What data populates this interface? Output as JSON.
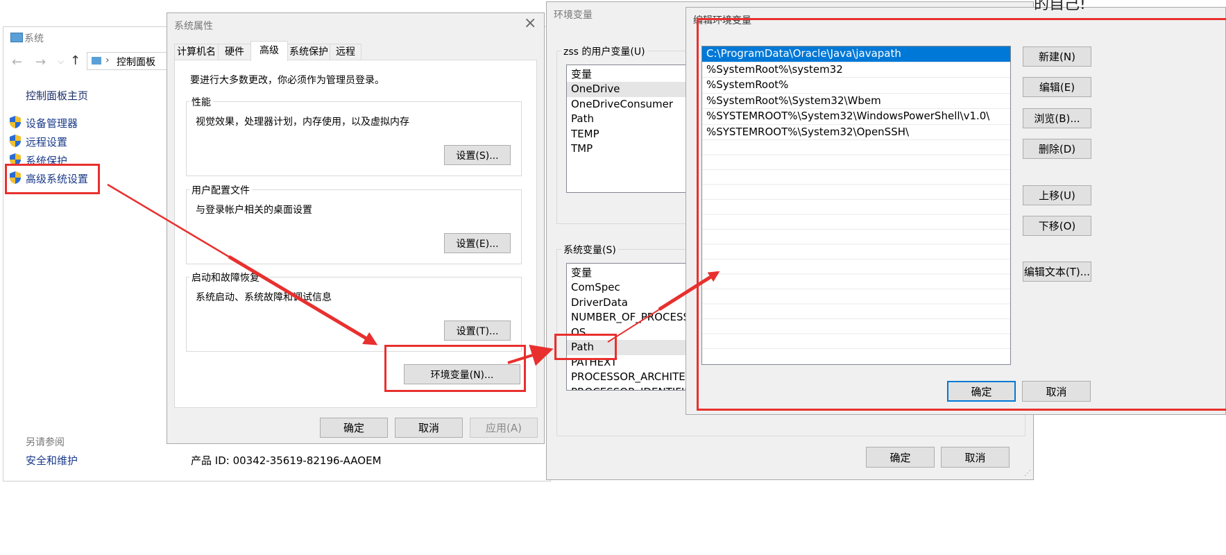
{
  "system_window": {
    "title": "系统",
    "address_label": "控制面板",
    "home_link": "控制面板主页",
    "nav_items": [
      "设备管理器",
      "远程设置",
      "系统保护",
      "高级系统设置"
    ],
    "see_also": "另请参阅",
    "security_link": "安全和维护",
    "product_id": "产品 ID: 00342-35619-82196-AAOEM"
  },
  "sys_props": {
    "title": "系统属性",
    "close": "×",
    "tabs": [
      "计算机名",
      "硬件",
      "高级",
      "系统保护",
      "远程"
    ],
    "admin_note": "要进行大多数更改，你必须作为管理员登录。",
    "perf_label": "性能",
    "perf_desc": "视觉效果，处理器计划，内存使用，以及虚拟内存",
    "perf_btn": "设置(S)...",
    "profile_label": "用户配置文件",
    "profile_desc": "与登录帐户相关的桌面设置",
    "profile_btn": "设置(E)...",
    "startup_label": "启动和故障恢复",
    "startup_desc": "系统启动、系统故障和调试信息",
    "startup_btn": "设置(T)...",
    "env_btn": "环境变量(N)...",
    "ok": "确定",
    "cancel": "取消",
    "apply": "应用(A)"
  },
  "env_vars": {
    "title": "环境变量",
    "user_label": "zss 的用户变量(U)",
    "user_header": "变量",
    "user_vars": [
      "OneDrive",
      "OneDriveConsumer",
      "Path",
      "TEMP",
      "TMP"
    ],
    "sys_label": "系统变量(S)",
    "sys_header": "变量",
    "sys_vars": [
      "ComSpec",
      "DriverData",
      "NUMBER_OF_PROCESSOR",
      "OS",
      "Path",
      "PATHEXT",
      "PROCESSOR_ARCHITECTU",
      "PROCESSOR_IDENTIFIER"
    ],
    "ok": "确定",
    "cancel": "取消"
  },
  "edit_env": {
    "title": "编辑环境变量",
    "paths": [
      "C:\\ProgramData\\Oracle\\Java\\javapath",
      "%SystemRoot%\\system32",
      "%SystemRoot%",
      "%SystemRoot%\\System32\\Wbem",
      "%SYSTEMROOT%\\System32\\WindowsPowerShell\\v1.0\\",
      "%SYSTEMROOT%\\System32\\OpenSSH\\"
    ],
    "new_btn": "新建(N)",
    "edit_btn": "编辑(E)",
    "browse_btn": "浏览(B)...",
    "delete_btn": "删除(D)",
    "up_btn": "上移(U)",
    "down_btn": "下移(O)",
    "edit_text_btn": "编辑文本(T)...",
    "ok": "确定",
    "cancel": "取消"
  },
  "top_fragment": "的自己!",
  "colors": {
    "highlight": "#0078d7",
    "annotation_red": "#e8302e",
    "link": "#1a3a8a"
  }
}
